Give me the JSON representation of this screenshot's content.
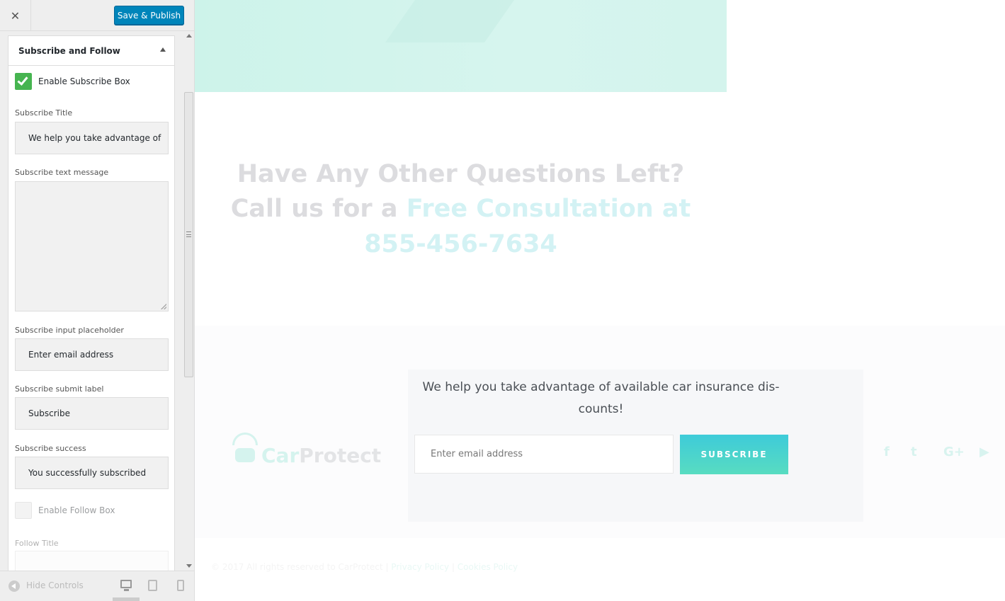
{
  "panel": {
    "close_glyph": "✕",
    "save_label": "Save & Publish",
    "section_title": "Subscribe and Follow",
    "enable_subscribe_label": "Enable Subscribe Box",
    "enable_subscribe_checked": true,
    "fields": {
      "title_label": "Subscribe Title",
      "title_value": "We help you take advantage of",
      "text_label": "Subscribe text message",
      "text_value": "",
      "placeholder_label": "Subscribe input placeholder",
      "placeholder_value": "Enter email address",
      "submit_label": "Subscribe submit label",
      "submit_value": "Subscribe",
      "success_label": "Subscribe success",
      "success_value": "You successfully subscribed"
    },
    "enable_follow_label": "Enable Follow Box",
    "enable_follow_checked": false,
    "follow_title_label": "Follow Title",
    "footer": {
      "hide_label": "Hide Controls",
      "devices": [
        "desktop-icon",
        "tablet-icon",
        "mobile-icon"
      ],
      "active_device": "desktop"
    }
  },
  "preview": {
    "cta": {
      "line1": "Have Any Other Questions Left?",
      "line2_plain": "Call us for a ",
      "line2_accent": "Free Consultation at",
      "line3_accent": "855-456-7634"
    },
    "logo": {
      "part1": "Car",
      "part2": "Protect"
    },
    "subscribe": {
      "title": "We help you take advantage of available car insurance dis-counts!",
      "input_placeholder": "Enter email address",
      "button_label": "SUBSCRIBE"
    },
    "social_icons": [
      "facebook-icon",
      "twitter-icon",
      "google-plus-icon",
      "youtube-icon"
    ],
    "social_glyphs": {
      "facebook": "f",
      "twitter": "t",
      "google_plus": "G+",
      "youtube": "▶"
    },
    "copyright": {
      "text": "© 2017 All rights reserved to CarProtect",
      "sep1": " | ",
      "privacy": "Privacy Policy",
      "sep2": " | ",
      "cookies": "Cookies Policy"
    }
  },
  "colors": {
    "save_button": "#0085ba",
    "checkbox_on": "#46b450",
    "accent": "#3ecbd9",
    "accent_2": "#58dcc1"
  }
}
